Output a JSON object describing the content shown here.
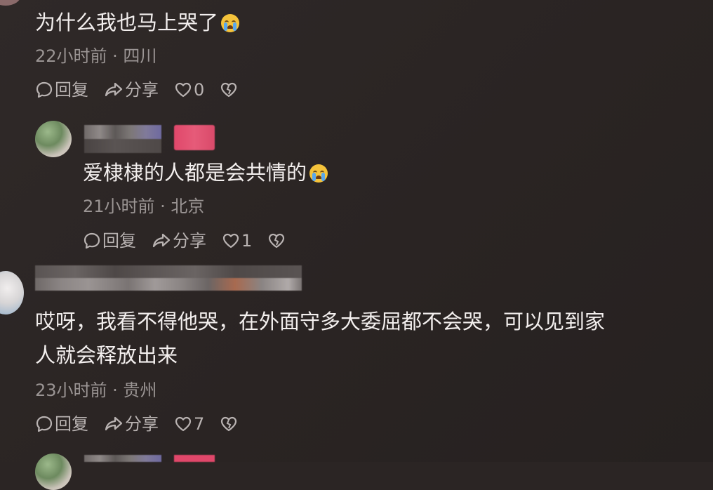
{
  "comments": [
    {
      "text": "为什么我也马上哭了",
      "meta": "22小时前 · 四川",
      "reply_label": "回复",
      "share_label": "分享",
      "likes": "0",
      "emoji_icon": "crying-face-icon"
    },
    {
      "text": "爱棣棣的人都是会共情的",
      "meta": "21小时前 · 北京",
      "reply_label": "回复",
      "share_label": "分享",
      "likes": "1",
      "emoji_icon": "crying-face-icon"
    },
    {
      "text_line1": "哎呀，我看不得他哭，在外面守多大委屈都不会哭，可以见到家",
      "text_line2": "人就会释放出来",
      "meta": "23小时前 · 贵州",
      "reply_label": "回复",
      "share_label": "分享",
      "likes": "7"
    }
  ],
  "colors": {
    "background": "#2b2524",
    "text": "#f3efee",
    "meta": "#9b9594",
    "action": "#b9b3b2",
    "badge_pink": "#e0476a"
  }
}
